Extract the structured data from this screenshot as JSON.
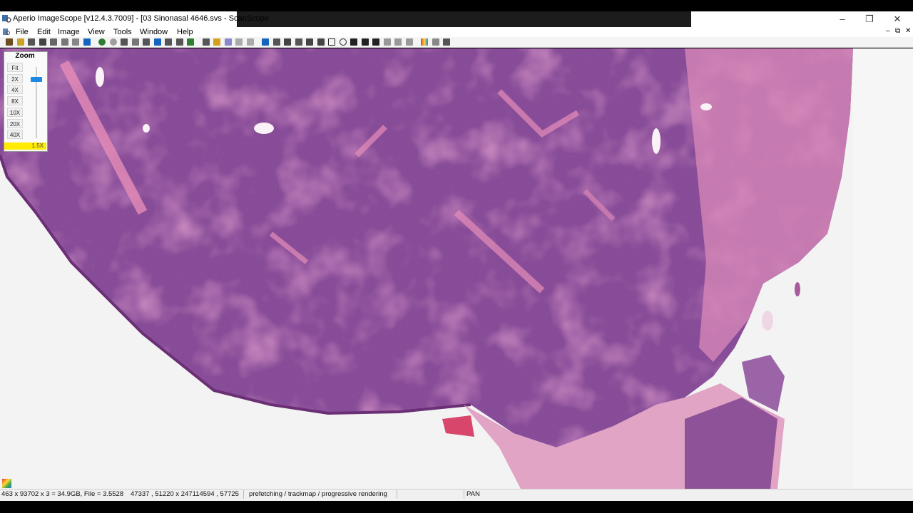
{
  "window": {
    "title": "Aperio ImageScope [v12.4.3.7009] - [03 Sinonasal 4646.svs - ScanScope",
    "controls": {
      "minimize": "–",
      "maximize": "❐",
      "close": "✕"
    }
  },
  "menu": {
    "items": [
      "File",
      "Edit",
      "Image",
      "View",
      "Tools",
      "Window",
      "Help"
    ],
    "mdi_controls": [
      "–",
      "⧉",
      "✕"
    ]
  },
  "toolbar": {
    "icons": [
      "open-folder-icon",
      "folder-icon",
      "camera-icon",
      "print-icon",
      "print-preview-icon",
      "tree-icon",
      "expand-icon",
      "info-icon",
      "go-icon",
      "stop-icon",
      "navigate-icon",
      "refresh-icon",
      "select-region-icon",
      "bookmark-icon",
      "copy-view-icon",
      "magnify-icon",
      "snapshot-icon",
      "pen-icon",
      "highlight-icon",
      "brush-icon",
      "undo-icon",
      "redo-icon",
      "pan-tool-icon",
      "select-tool-icon",
      "annotation-icon",
      "arrow-tool-icon",
      "ruler-icon",
      "ruler2-icon",
      "rectangle-icon",
      "ellipse-icon",
      "line-icon",
      "grid-icon",
      "list-icon",
      "layers-icon",
      "layers2-icon",
      "layers3-icon",
      "color-icon",
      "settings-icon",
      "help-icon"
    ]
  },
  "zoom": {
    "title": "Zoom",
    "levels": [
      "Fit",
      "2X",
      "4X",
      "8X",
      "10X",
      "20X",
      "40X"
    ],
    "current": "1.5X",
    "slider_level": 0.14
  },
  "status": {
    "dimensions": "463 x 93702 x 3 = 34.9GB, File = 3.5528",
    "coords": "47337 , 51220 x 247114594 , 57725",
    "rendering": "prefetching / trackmap / progressive rendering",
    "mode": "PAN"
  },
  "colors": {
    "tissue_dark": "#7a3d86",
    "tissue_pink": "#d66aa6",
    "stroma": "#e58cb2",
    "background": "#f3f3f3",
    "zoom_highlight": "#ffea00",
    "slider": "#1e88e5"
  }
}
